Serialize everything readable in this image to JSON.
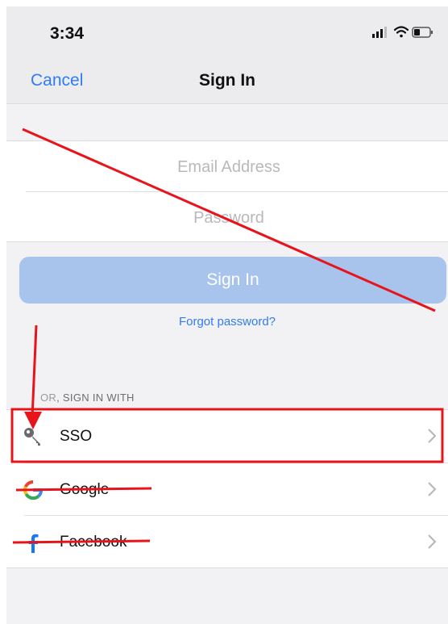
{
  "status_bar": {
    "time": "3:34",
    "icons": [
      "signal-icon",
      "wifi-icon",
      "battery-icon"
    ]
  },
  "nav": {
    "cancel_label": "Cancel",
    "title": "Sign In"
  },
  "form": {
    "email_placeholder": "Email Address",
    "password_placeholder": "Password"
  },
  "signin_button_label": "Sign In",
  "forgot_password_label": "Forgot password?",
  "section_header": {
    "prefix": "OR",
    "text": ", SIGN IN WITH"
  },
  "providers": [
    {
      "label": "SSO",
      "icon": "key-icon"
    },
    {
      "label": "Google",
      "icon": "google-icon"
    },
    {
      "label": "Facebook",
      "icon": "facebook-icon"
    }
  ],
  "colors": {
    "accent": "#2f7cf6",
    "button": "#a8c4ec",
    "annotation": "#e8141c"
  }
}
